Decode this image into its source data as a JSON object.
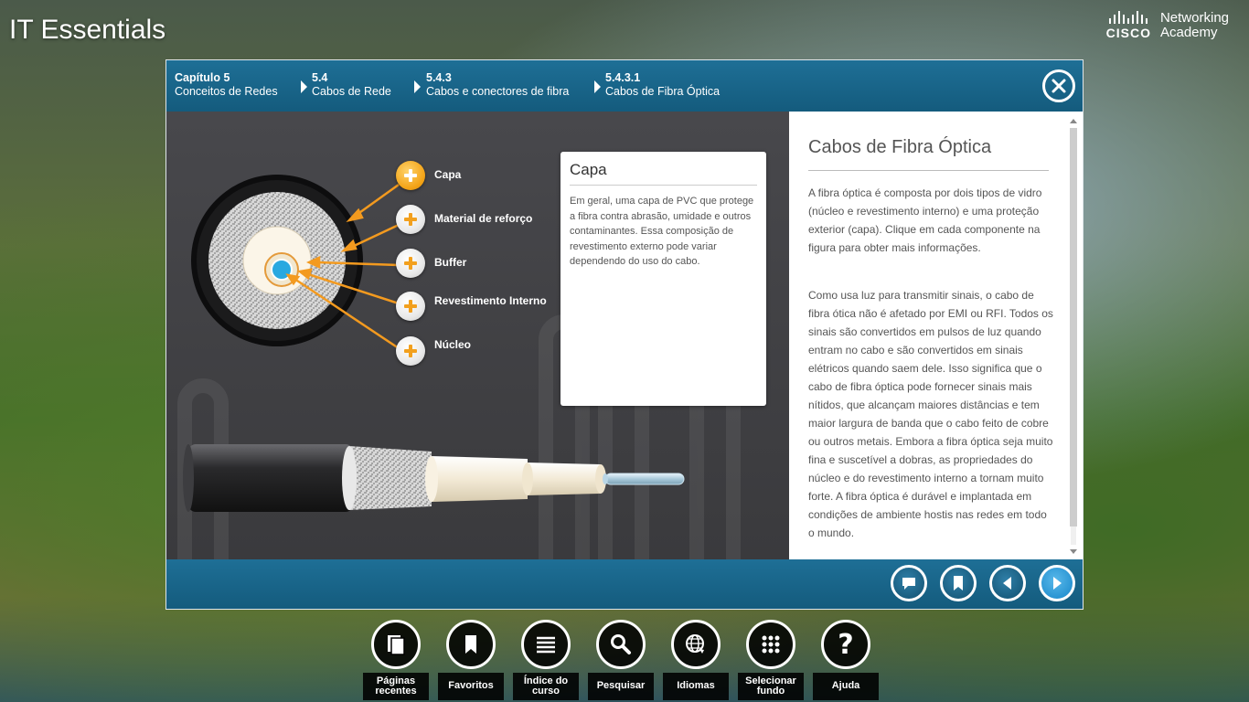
{
  "app": {
    "title": "IT Essentials"
  },
  "brand": {
    "cisco": "CISCO",
    "line1": "Networking",
    "line2": "Academy"
  },
  "breadcrumb": [
    {
      "num": "Capítulo 5",
      "label": "Conceitos de Redes"
    },
    {
      "num": "5.4",
      "label": "Cabos de Rede"
    },
    {
      "num": "5.4.3",
      "label": "Cabos e conectores de fibra"
    },
    {
      "num": "5.4.3.1",
      "label": "Cabos de Fibra Óptica"
    }
  ],
  "figure": {
    "components": [
      {
        "label": "Capa",
        "active": true
      },
      {
        "label": "Material de reforço",
        "active": false
      },
      {
        "label": "Buffer",
        "active": false
      },
      {
        "label": "Revestimento Interno",
        "active": false
      },
      {
        "label": "Núcleo",
        "active": false
      }
    ],
    "callout": {
      "title": "Capa",
      "text": "Em geral, uma capa de PVC que protege a fibra contra abrasão, umidade e outros contaminantes. Essa composição de revestimento externo pode variar dependendo do uso do cabo."
    },
    "colors": {
      "accent": "#f39a1f",
      "core": "#29a8e0"
    }
  },
  "panel": {
    "title": "Cabos de Fibra Óptica",
    "paragraphs": [
      "A fibra óptica é composta por dois tipos de vidro (núcleo e revestimento interno) e uma proteção exterior (capa). Clique em cada componente na figura para obter mais informações.",
      "Como usa luz para transmitir sinais, o cabo de fibra ótica não é afetado por EMI ou RFI. Todos os sinais são convertidos em pulsos de luz quando entram no cabo e são convertidos em sinais elétricos quando saem dele. Isso significa que o cabo de fibra óptica pode fornecer sinais mais nítidos, que alcançam maiores distâncias e tem maior largura de banda que o cabo feito de cobre ou outros metais. Embora a fibra óptica seja muito fina e suscetível a dobras, as propriedades do núcleo e do revestimento interno a tornam muito forte. A fibra óptica é durável e implantada em condições de ambiente hostis nas redes em todo o mundo."
    ]
  },
  "nav_buttons": [
    "comment-icon",
    "bookmark-icon",
    "previous-icon",
    "next-icon"
  ],
  "dock": [
    {
      "label": "Páginas\nrecentes",
      "icon": "pages-icon"
    },
    {
      "label": "Favoritos",
      "icon": "bookmark-icon"
    },
    {
      "label": "Índice do\ncurso",
      "icon": "list-icon"
    },
    {
      "label": "Pesquisar",
      "icon": "search-icon"
    },
    {
      "label": "Idiomas",
      "icon": "globe-icon"
    },
    {
      "label": "Selecionar\nfundo",
      "icon": "grid-icon"
    },
    {
      "label": "Ajuda",
      "icon": "help-icon"
    }
  ]
}
